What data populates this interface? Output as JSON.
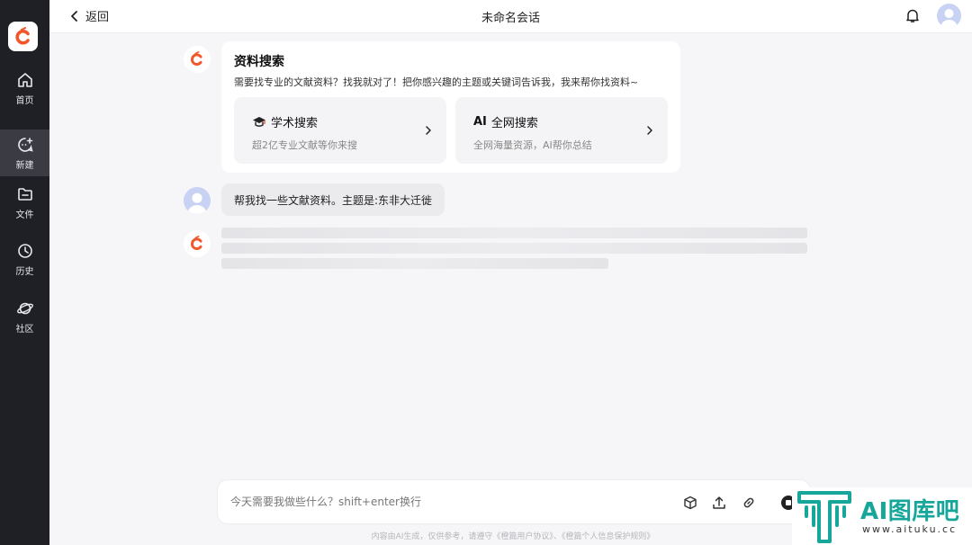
{
  "sidebar": {
    "items": [
      {
        "label": "首页",
        "icon": "home-icon"
      },
      {
        "label": "新建",
        "icon": "new-chat-icon"
      },
      {
        "label": "文件",
        "icon": "file-icon"
      },
      {
        "label": "历史",
        "icon": "history-icon"
      },
      {
        "label": "社区",
        "icon": "planet-icon"
      }
    ],
    "active_index": 1
  },
  "header": {
    "back_label": "返回",
    "title": "未命名会话"
  },
  "card": {
    "title": "资料搜索",
    "description": "需要找专业的文献资料？找我就对了！把你感兴趣的主题或关键词告诉我，我来帮你找资料~",
    "options": [
      {
        "title": "学术搜索",
        "subtitle": "超2亿专业文献等你来搜",
        "icon": "graduation-cap-icon"
      },
      {
        "title": "全网搜索",
        "subtitle": "全网海量资源，AI帮你总结",
        "icon": "ai-icon",
        "icon_text": "AI"
      }
    ]
  },
  "user_message": "帮我找一些文献资料。主题是:东非大迁徙",
  "input": {
    "placeholder": "今天需要我做些什么？shift+enter换行"
  },
  "footer_note": "内容由AI生成，仅供参考，请遵守《橙篇用户协议》、《橙篇个人信息保护规则》",
  "watermark": {
    "text": "AI图库吧",
    "url": "www.aituku.cc"
  },
  "colors": {
    "brand_orange": "#f2572b",
    "sidebar_bg": "#1f2026",
    "watermark_teal": "#16a69a"
  }
}
